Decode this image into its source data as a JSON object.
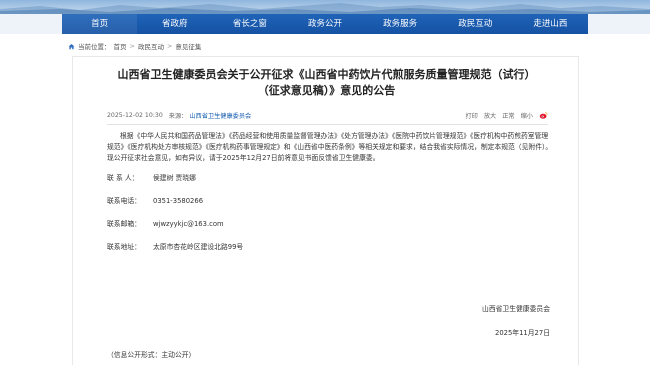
{
  "nav": {
    "items": [
      {
        "label": "首页"
      },
      {
        "label": "省政府"
      },
      {
        "label": "省长之窗"
      },
      {
        "label": "政务公开"
      },
      {
        "label": "政务服务"
      },
      {
        "label": "政民互动"
      },
      {
        "label": "走进山西"
      }
    ]
  },
  "breadcrumb": {
    "prefix": "当前位置：",
    "items": [
      "首页",
      "政民互动",
      "意见征集"
    ],
    "separator": ">"
  },
  "article": {
    "title_line1": "山西省卫生健康委员会关于公开征求《山西省中药饮片代煎服务质量管理规范（试行）",
    "title_line2": "（征求意见稿）》意见的公告",
    "date": "2025-12-02 10:30",
    "source_label": "来源：",
    "source": "山西省卫生健康委员会",
    "print": "打印",
    "font_large": "放大",
    "font_default": "正常",
    "font_small": "缩小",
    "share_icon": "weibo-icon",
    "paragraph": "根据《中华人民共和国药品管理法》《药品经营和使用质量监督管理办法》《处方管理办法》《医院中药饮片管理规范》《医疗机构中药煎药室管理规范》《医疗机构处方审核规范》《医疗机构药事管理规定》和《山西省中医药条例》等相关规定和要求，结合我省实际情况，制定本规范（见附件）。现公开征求社会意见，如有异议，请于2025年12月27日前将意见书面反馈省卫生健康委。",
    "contacts": [
      {
        "label": "联 系 人：",
        "value": "侯建树  贾晓娜"
      },
      {
        "label": "联系电话：",
        "value": "0351-3580266"
      },
      {
        "label": "联系邮箱：",
        "value": "wjwzyykjc@163.com"
      },
      {
        "label": "联系地址：",
        "value": "太原市杏花岭区建设北路99号"
      }
    ],
    "signature_org": "山西省卫生健康委员会",
    "signature_date": "2025年11月27日",
    "disclosure": "（信息公开形式：主动公开）"
  },
  "colors": {
    "nav_bg": "#1a5bb0",
    "link": "#1a5fb4",
    "title": "#222222"
  }
}
